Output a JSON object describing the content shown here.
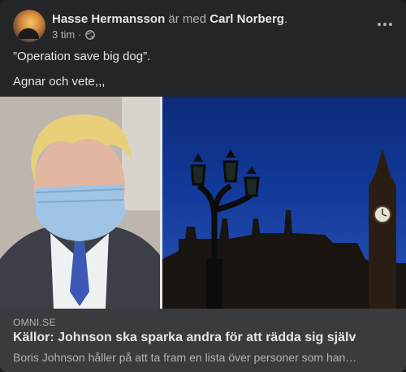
{
  "post": {
    "author": "Hasse Hermansson",
    "with_text": " är med ",
    "tagged": "Carl Norberg",
    "tagged_suffix": ".",
    "time": "3 tim",
    "separator": "·",
    "privacy_icon": "globe-icon",
    "more_icon": "more-options-icon",
    "lines": [
      "”Operation save big dog”.",
      "Agnar och vete,,,"
    ]
  },
  "link": {
    "domain": "OMNI.SE",
    "title": "Källor: Johnson ska sparka andra för att rädda sig själv",
    "description": "Boris Johnson håller på att ta fram en lista över personer som han…"
  },
  "colors": {
    "card_bg": "#242526",
    "link_bg": "#3a3b3c",
    "text_primary": "#e4e6eb",
    "text_secondary": "#b0b3b8",
    "sky": "#123a9a"
  }
}
